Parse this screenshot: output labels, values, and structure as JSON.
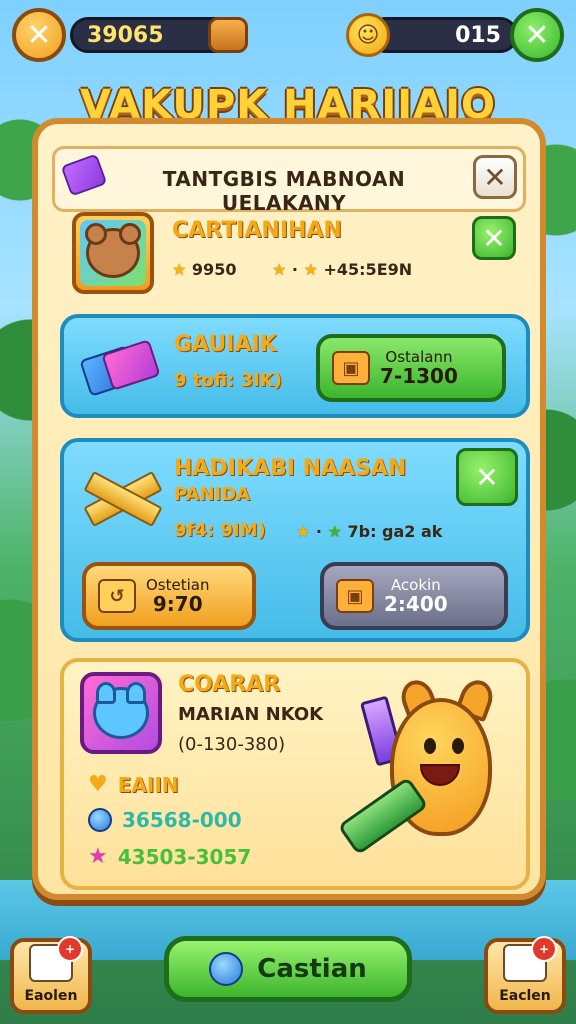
{
  "top_bar": {
    "coins": "39065",
    "gems": "015"
  },
  "title": "VAKUPK HARIIAJO",
  "panel": {
    "subtitle": "TANTGBIS MABNOAN UELAKANY",
    "profile": {
      "name": "CARTIANIHAN",
      "score": "9950",
      "rating": "+45:5E9N"
    },
    "item_card": {
      "name": "GAUIAIK",
      "detail": "9 tofi: 3IK)",
      "button_line1": "Ostalann",
      "button_line2": "7-1300"
    },
    "quest_card": {
      "title": "HADIKABI NAASAN",
      "subtitle": "PANIDA",
      "detail": "9f4: 9IM)",
      "rating": "7b: ga2 ak",
      "button_left_line1": "Ostetian",
      "button_left_line2": "9:70",
      "button_right_line1": "Acokin",
      "button_right_line2": "2:400"
    },
    "character_card": {
      "name": "COARAR",
      "subtitle": "MARIAN NKOK",
      "range": "(0-130-380)",
      "stat1_label": "EAIIN",
      "stat2_value": "36568-000",
      "stat3_value": "43503-3057",
      "stat1_color": "#f4a916",
      "stat2_color": "#2fb8a8",
      "stat3_color": "#48c03a"
    }
  },
  "bottom_nav": {
    "left_label": "Eaolen",
    "left_badge": "+",
    "main_label": "Castian",
    "right_label": "Eaclen",
    "right_badge": "+"
  }
}
